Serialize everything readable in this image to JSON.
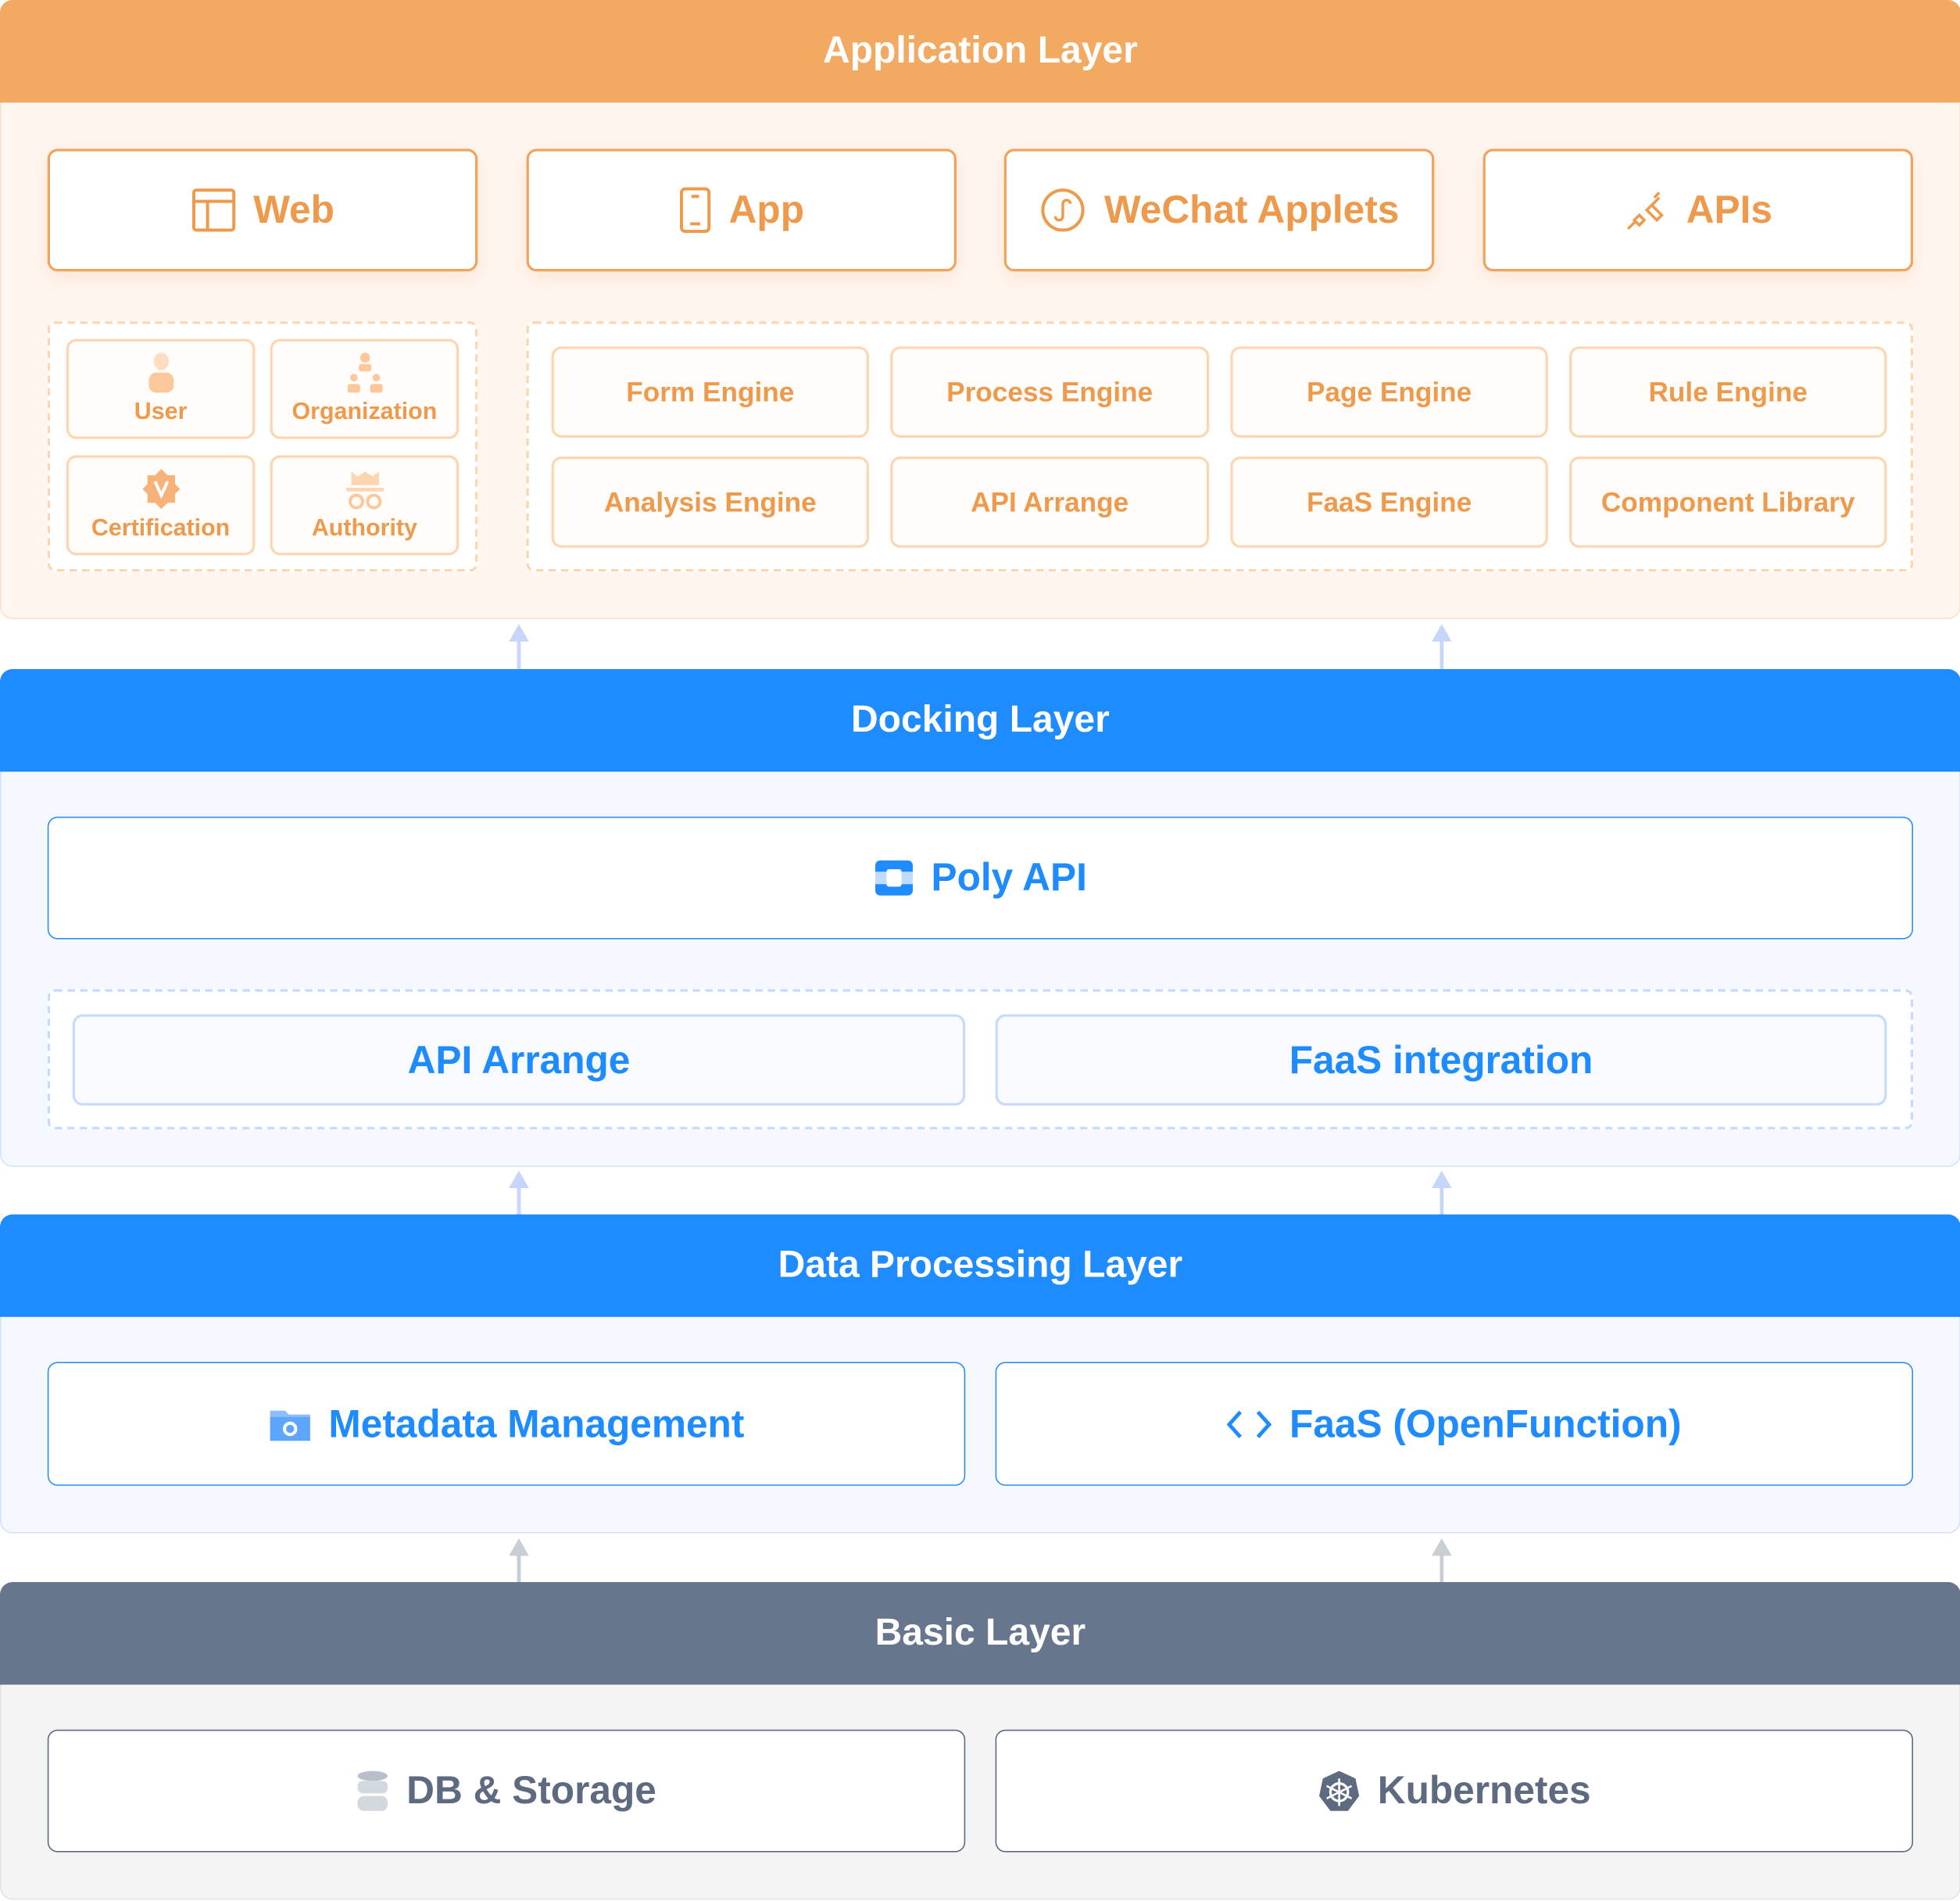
{
  "colors": {
    "application": "#F2A962",
    "docking": "#1E8BFF",
    "data_processing": "#1E8BFF",
    "basic": "#67768C"
  },
  "application": {
    "title": "Application Layer",
    "clients": [
      {
        "label": "Web",
        "icon": "layout-icon"
      },
      {
        "label": "App",
        "icon": "mobile-icon"
      },
      {
        "label": "WeChat Applets",
        "icon": "mini-program-icon"
      },
      {
        "label": "APIs",
        "icon": "plug-icon"
      }
    ],
    "access": [
      {
        "label": "User",
        "icon": "user-icon"
      },
      {
        "label": "Organization",
        "icon": "org-chart-icon"
      },
      {
        "label": "Certification",
        "icon": "badge-icon"
      },
      {
        "label": "Authority",
        "icon": "incognito-icon"
      }
    ],
    "engines": [
      "Form Engine",
      "Process Engine",
      "Page Engine",
      "Rule Engine",
      "Analysis Engine",
      "API Arrange",
      "FaaS Engine",
      "Component Library"
    ]
  },
  "docking": {
    "title": "Docking Layer",
    "main": {
      "label": "Poly API",
      "icon": "api-block-icon"
    },
    "subs": [
      "API Arrange",
      "FaaS integration"
    ]
  },
  "data_processing": {
    "title": "Data Processing Layer",
    "items": [
      {
        "label": "Metadata Management",
        "icon": "folder-gear-icon"
      },
      {
        "label": "FaaS (OpenFunction)",
        "icon": "code-icon"
      }
    ]
  },
  "basic": {
    "title": "Basic Layer",
    "items": [
      {
        "label": "DB & Storage",
        "icon": "database-icon"
      },
      {
        "label": "Kubernetes",
        "icon": "kubernetes-icon"
      }
    ]
  }
}
